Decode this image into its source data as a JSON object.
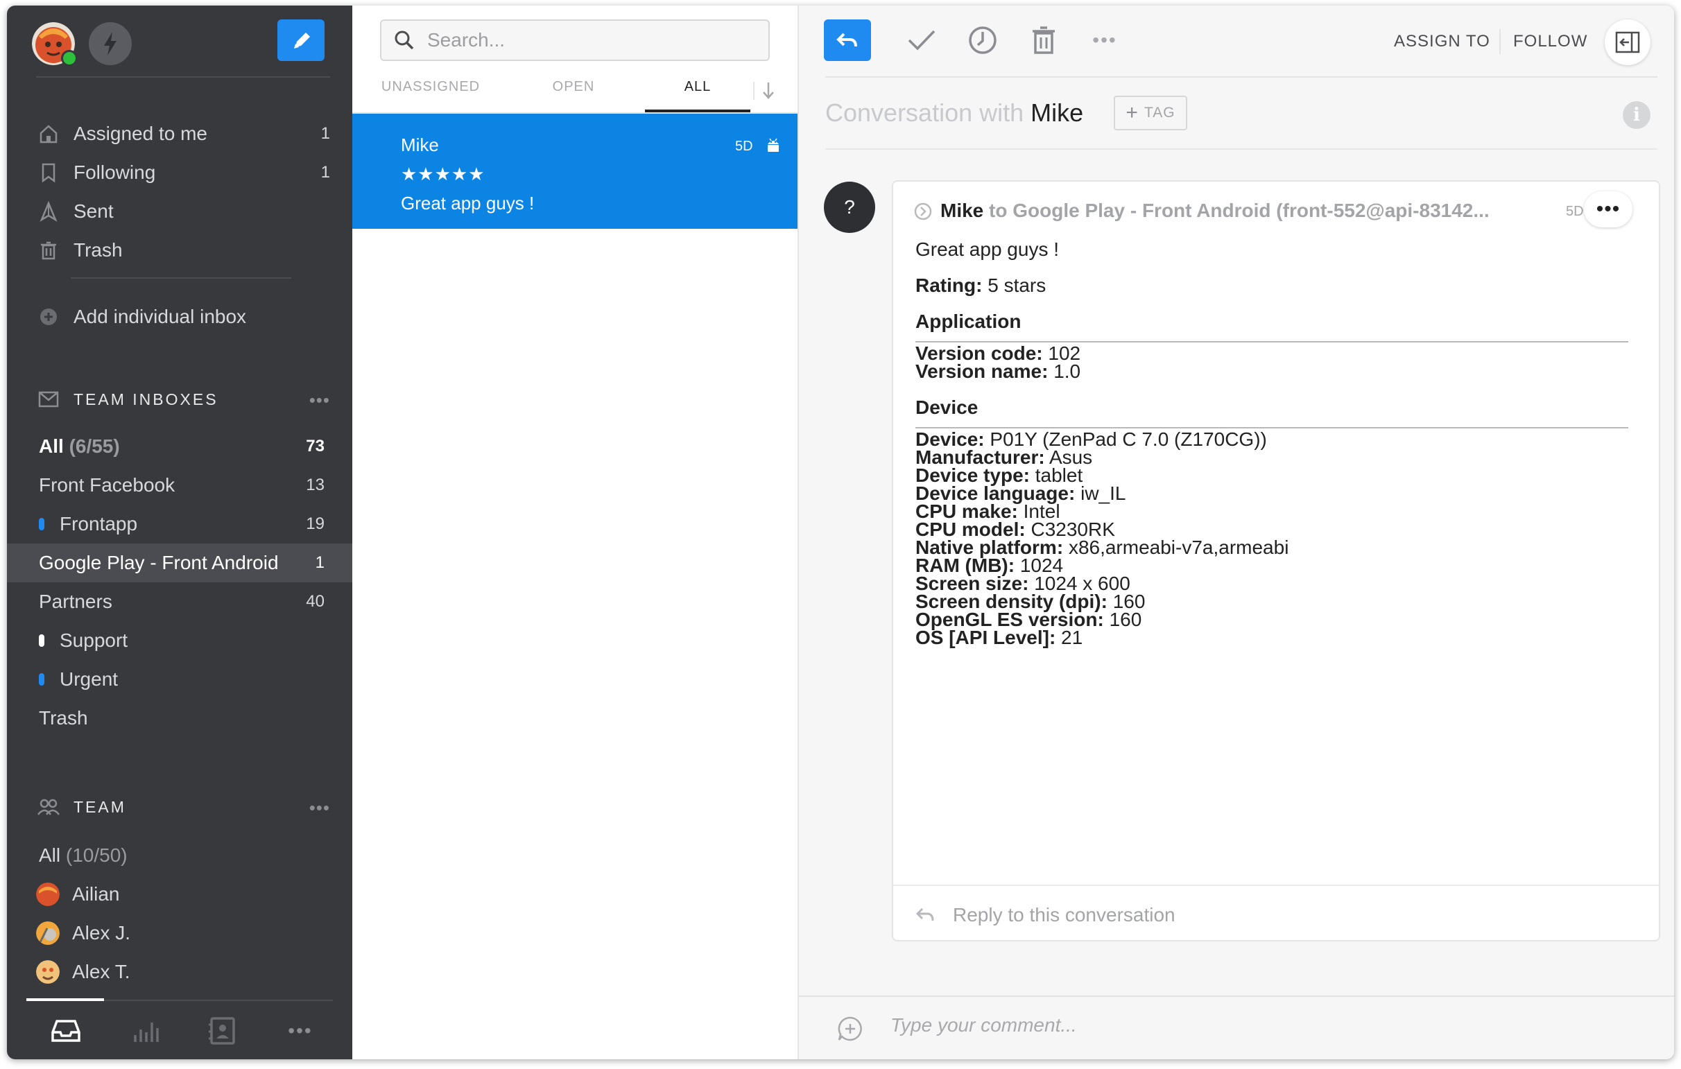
{
  "sidebar": {
    "nav": [
      {
        "label": "Assigned to me",
        "count": "1",
        "icon": "home-icon"
      },
      {
        "label": "Following",
        "count": "1",
        "icon": "bookmark-icon"
      },
      {
        "label": "Sent",
        "count": "",
        "icon": "send-icon"
      },
      {
        "label": "Trash",
        "count": "",
        "icon": "trash-icon"
      }
    ],
    "add_inbox": "Add individual inbox",
    "team_inboxes": {
      "title": "TEAM INBOXES",
      "more": "•••",
      "all_label": "All",
      "all_fraction": "(6/55)",
      "all_count": "73",
      "items": [
        {
          "label": "Front Facebook",
          "count": "13"
        },
        {
          "label": "Frontapp",
          "count": "19",
          "dot_color": "#1f8af0"
        },
        {
          "label": "Google Play - Front Android",
          "count": "1"
        },
        {
          "label": "Partners",
          "count": "40"
        },
        {
          "label": "Support",
          "count": "",
          "dot_color": "#ffffff"
        },
        {
          "label": "Urgent",
          "count": "",
          "dot_color": "#1f8af0"
        },
        {
          "label": "Trash",
          "count": ""
        }
      ]
    },
    "team": {
      "title": "TEAM",
      "more": "•••",
      "all_label": "All",
      "all_fraction": "(10/50)",
      "members": [
        "Ailian",
        "Alex J.",
        "Alex T."
      ]
    }
  },
  "list": {
    "search_placeholder": "Search...",
    "tabs": [
      "UNASSIGNED",
      "OPEN",
      "ALL"
    ],
    "active_tab": "ALL",
    "conversation": {
      "name": "Mike",
      "stars": "★★★★★",
      "preview": "Great app guys !",
      "time": "5D"
    }
  },
  "main": {
    "toolbar": {
      "assign": "ASSIGN TO",
      "follow": "FOLLOW"
    },
    "title_prefix": "Conversation with",
    "title_name": "Mike",
    "tag_label": "TAG",
    "tag_plus": "+",
    "avatar_char": "?",
    "message": {
      "from": "Mike",
      "to": "to Google Play - Front Android (front-552@api-83142...",
      "time": "5D",
      "greeting": "Great app guys !",
      "rating_label": "Rating:",
      "rating_value": "5 stars",
      "application_heading": "Application",
      "application": [
        {
          "k": "Version code:",
          "v": "102"
        },
        {
          "k": "Version name:",
          "v": "1.0"
        }
      ],
      "device_heading": "Device",
      "device": [
        {
          "k": "Device:",
          "v": "P01Y (ZenPad C 7.0 (Z170CG))"
        },
        {
          "k": "Manufacturer:",
          "v": "Asus"
        },
        {
          "k": "Device type:",
          "v": "tablet"
        },
        {
          "k": "Device language:",
          "v": "iw_IL"
        },
        {
          "k": "CPU make:",
          "v": "Intel"
        },
        {
          "k": "CPU model:",
          "v": "C3230RK"
        },
        {
          "k": "Native platform:",
          "v": "x86,armeabi-v7a,armeabi"
        },
        {
          "k": "RAM (MB):",
          "v": "1024"
        },
        {
          "k": "Screen size:",
          "v": "1024 x 600"
        },
        {
          "k": "Screen density (dpi):",
          "v": "160"
        },
        {
          "k": "OpenGL ES version:",
          "v": "160"
        },
        {
          "k": "OS [API Level]:",
          "v": "21"
        }
      ]
    },
    "reply_placeholder": "Reply to this conversation",
    "comment_placeholder": "Type your comment..."
  },
  "colors": {
    "accent": "#1f8af0",
    "selected_conversation": "#0b84e3",
    "sidebar": "#37393d"
  }
}
